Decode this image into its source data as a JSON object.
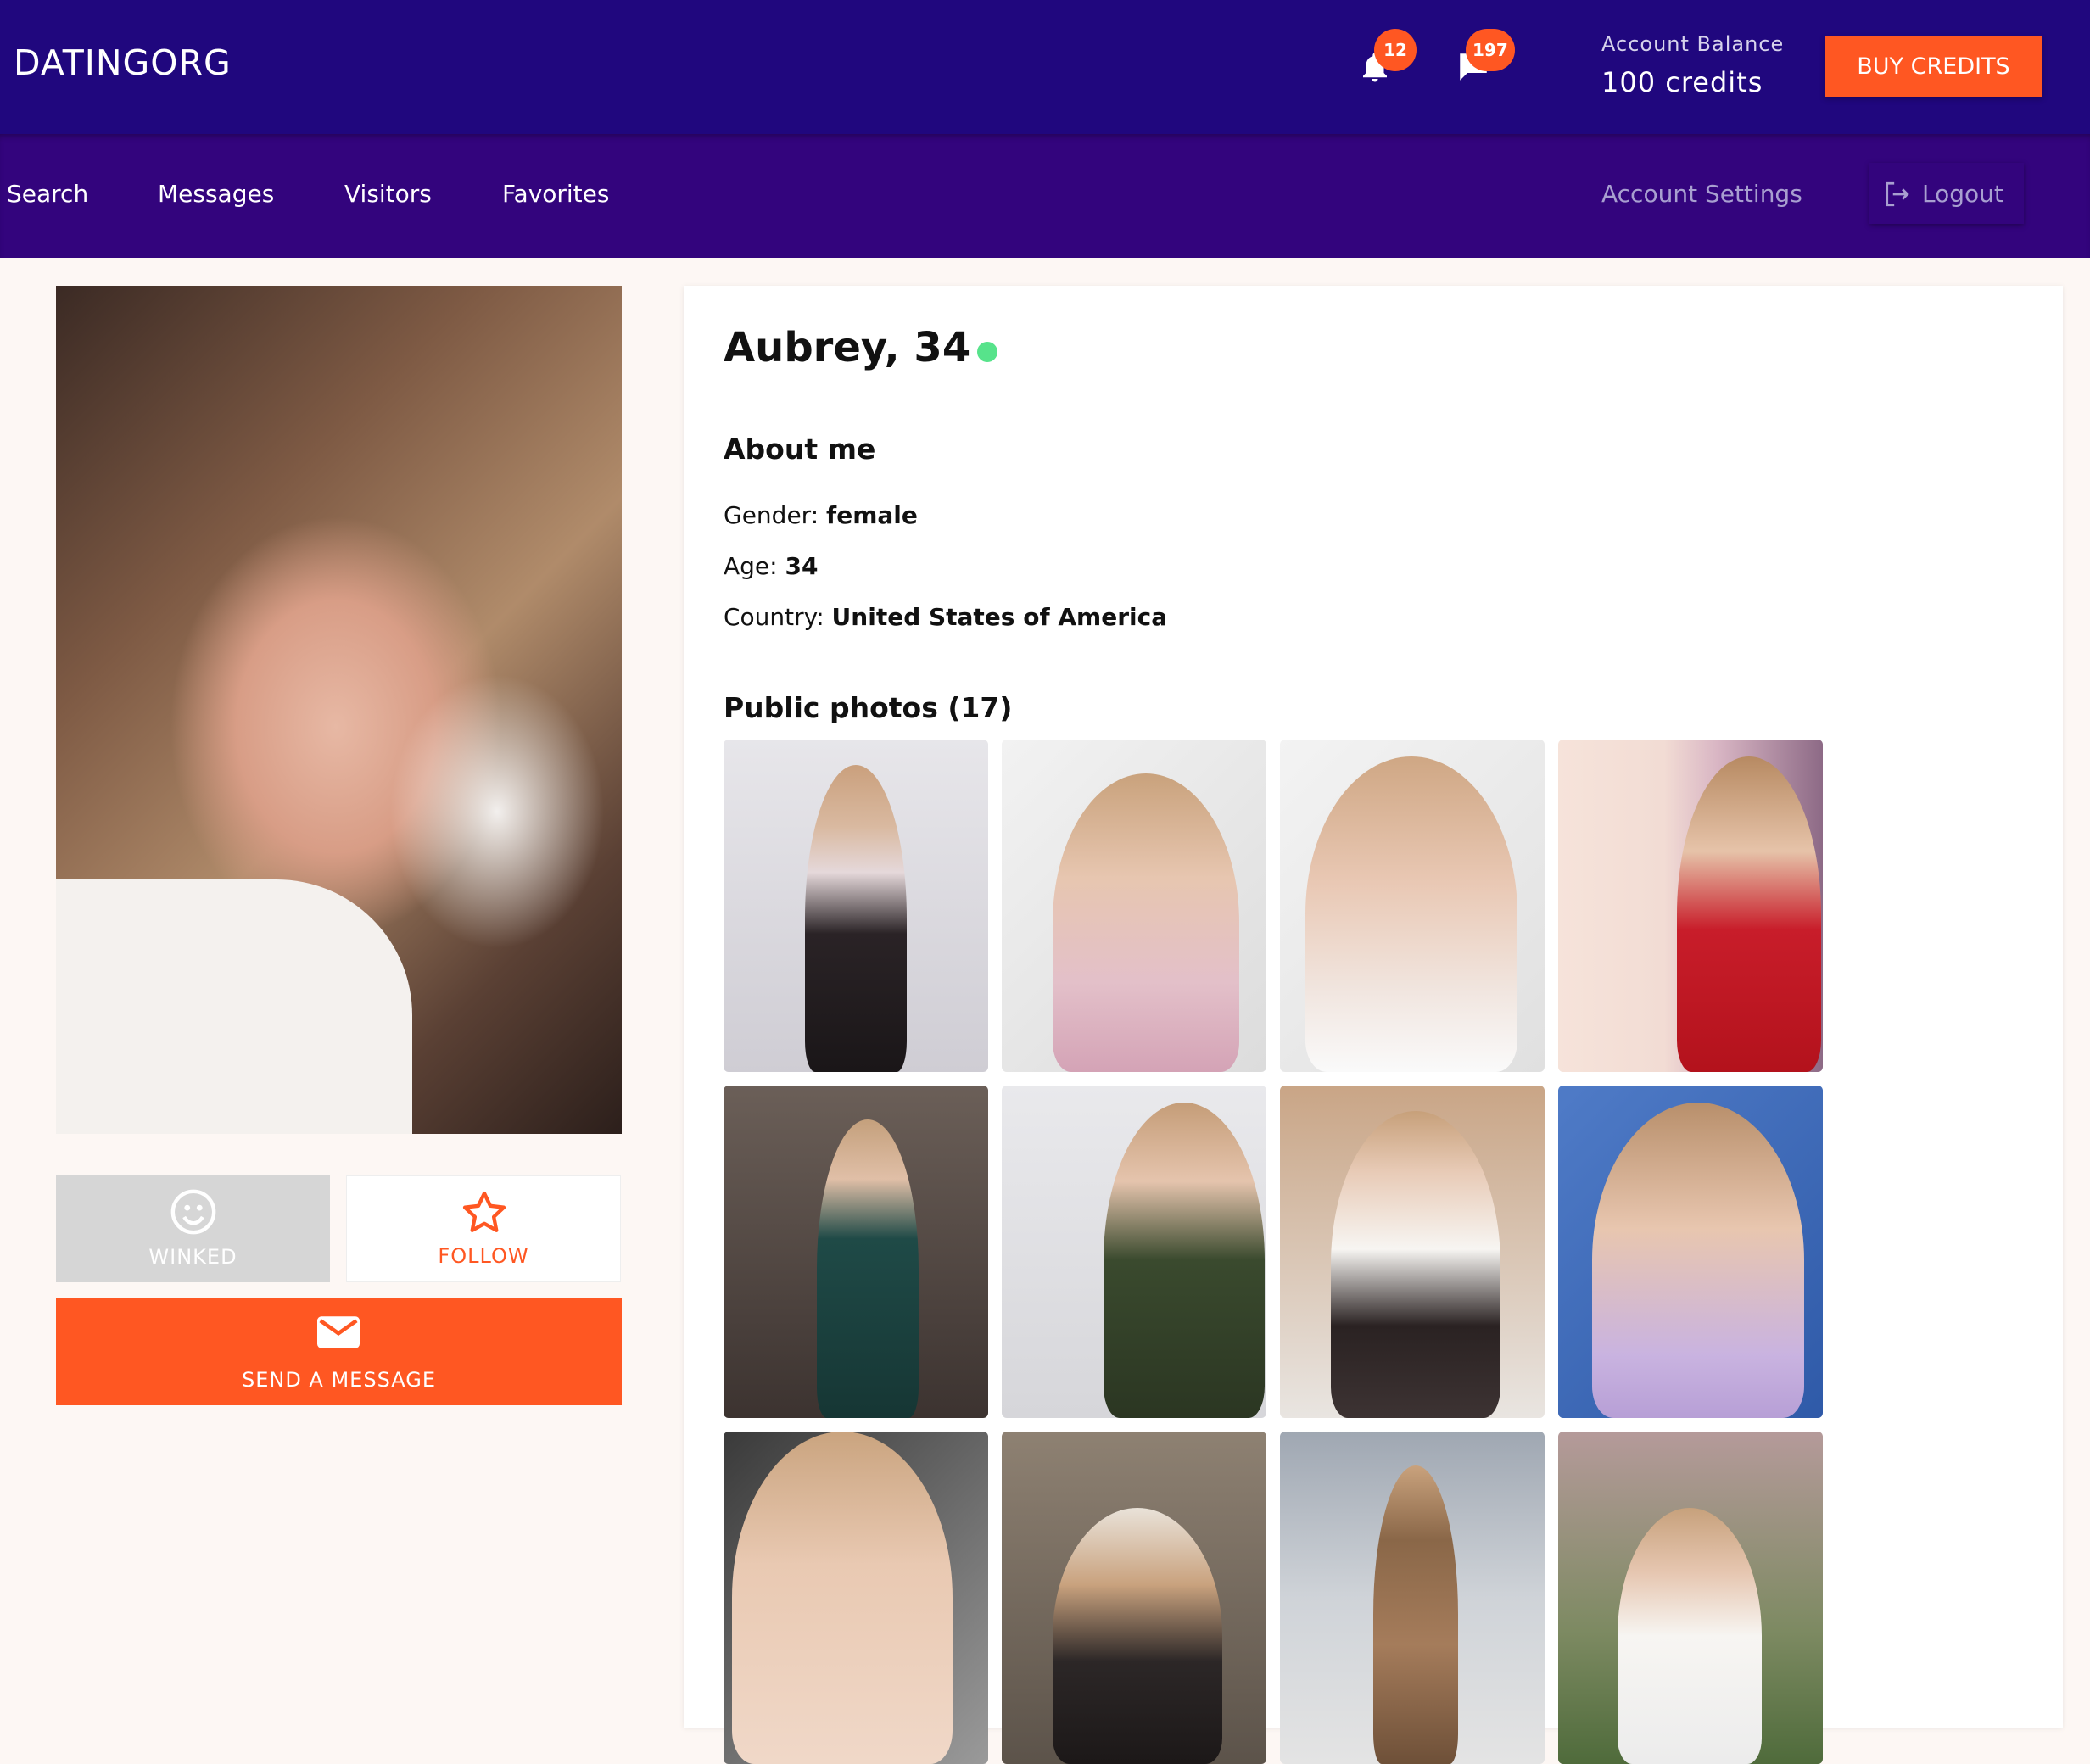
{
  "header": {
    "logo": "DATINGORG",
    "notifications_count": "12",
    "messages_count": "197",
    "balance_label": "Account Balance",
    "balance_value": "100 credits",
    "buy_label": "BUY CREDITS"
  },
  "nav": {
    "items": [
      "Search",
      "Messages",
      "Visitors",
      "Favorites"
    ],
    "settings": "Account Settings",
    "logout": "Logout"
  },
  "actions": {
    "wink": "WINKED",
    "follow": "FOLLOW",
    "message": "SEND A MESSAGE"
  },
  "profile": {
    "name": "Aubrey, 34",
    "online": true,
    "about_title": "About me",
    "gender_label": "Gender:",
    "gender": "female",
    "age_label": "Age:",
    "age": "34",
    "country_label": "Country:",
    "country": "United States of America",
    "photos_title": "Public photos (17)"
  },
  "colors": {
    "header": "#20077e",
    "nav": "#33047d",
    "accent": "#ff5722",
    "online": "#57e38b"
  }
}
